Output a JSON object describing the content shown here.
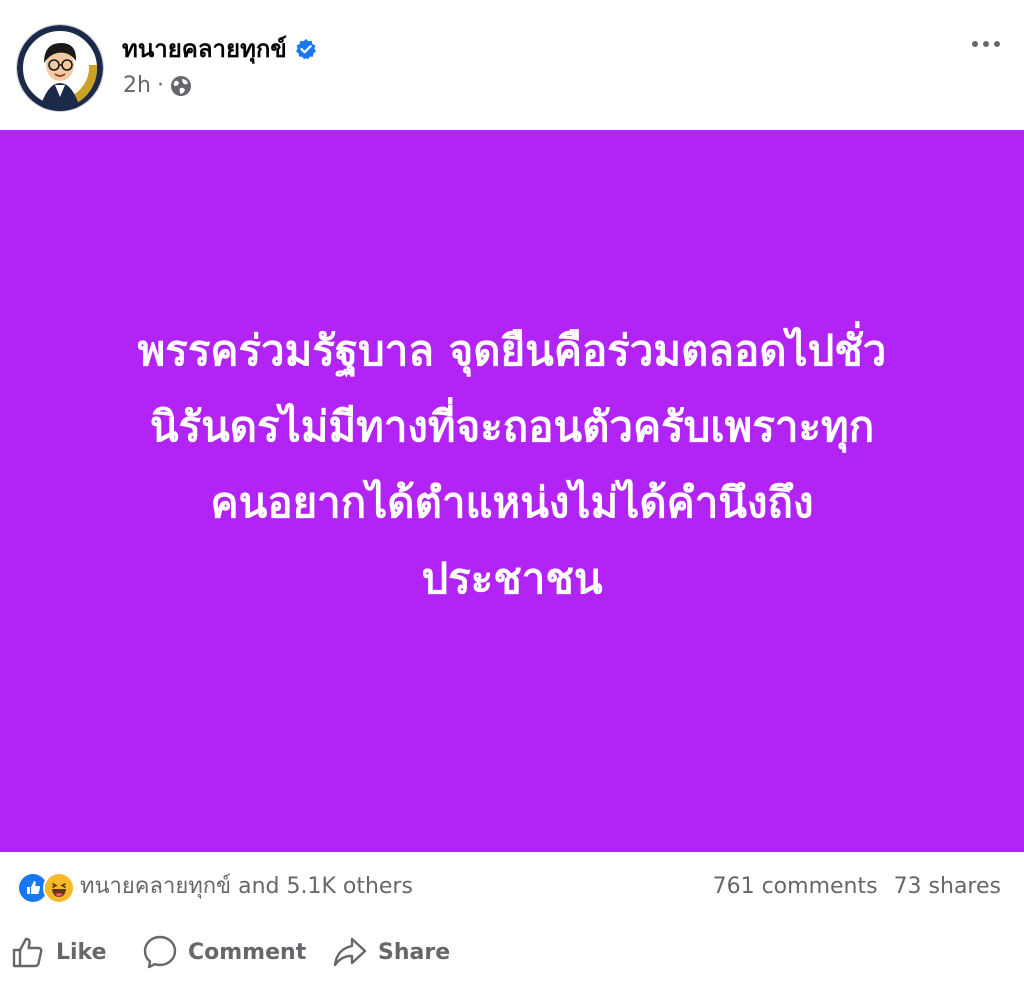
{
  "post": {
    "author_name": "ทนายคลายทุกข์",
    "timestamp": "2h",
    "separator": "·",
    "audience_icon": "globe-icon",
    "verified_icon": "verified-badge-icon",
    "more_icon": "more-horizontal-icon",
    "avatar_caption": "ทนายคลายทุกข์",
    "background_color": "#b224f5",
    "text_color": "#ffffff",
    "text_lines": [
      "พรรคร่วมรัฐบาล จุดยืนคือร่วมตลอดไปชั่ว",
      "นิรันดรไม่มีทางที่จะถอนตัวครับเพราะทุก",
      "คนอยากได้ตำแหน่งไม่ได้คำนึงถึง",
      "ประชาชน"
    ]
  },
  "reactions": {
    "icons": [
      "like-reaction-icon",
      "haha-reaction-icon"
    ],
    "summary": "ทนายคลายทุกข์ and 5.1K others",
    "comments": "761 comments",
    "shares": "73 shares"
  },
  "actions": {
    "like_label": "Like",
    "comment_label": "Comment",
    "share_label": "Share"
  },
  "colors": {
    "accent_blue": "#1877f2",
    "secondary_text": "#65676b",
    "haha_yellow": "#f7b928"
  }
}
